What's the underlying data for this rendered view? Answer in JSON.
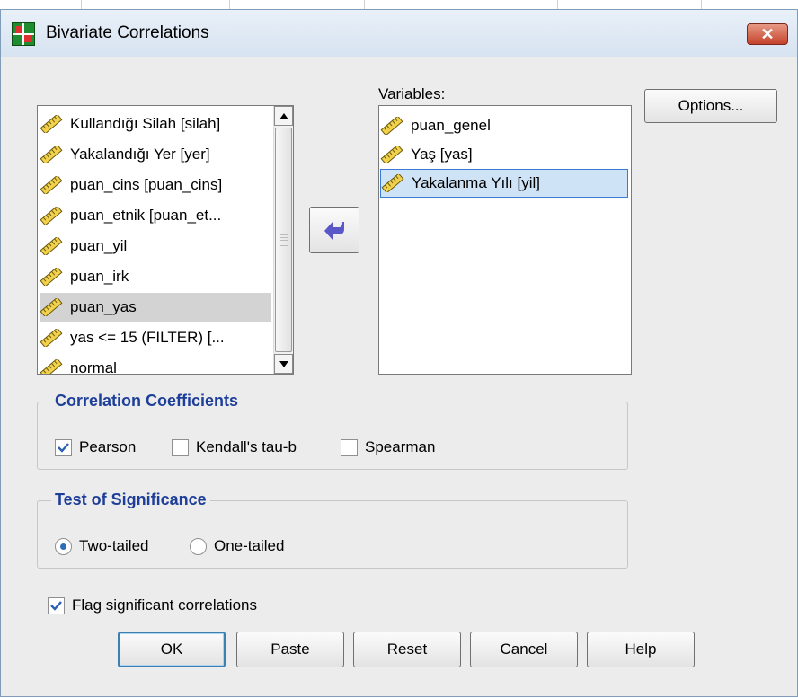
{
  "window": {
    "title": "Bivariate Correlations",
    "close_label": "✕"
  },
  "source_list": {
    "items": [
      {
        "label": "Kullandığı Silah [silah]"
      },
      {
        "label": "Yakalandığı Yer [yer]"
      },
      {
        "label": "puan_cins [puan_cins]"
      },
      {
        "label": "puan_etnik [puan_et..."
      },
      {
        "label": "puan_yil"
      },
      {
        "label": "puan_irk"
      },
      {
        "label": "puan_yas"
      },
      {
        "label": "yas <= 15 (FILTER) [..."
      },
      {
        "label": "normal"
      }
    ],
    "highlighted_index": 6
  },
  "variables": {
    "label": "Variables:",
    "items": [
      {
        "label": "puan_genel"
      },
      {
        "label": "Yaş [yas]"
      },
      {
        "label": "Yakalanma Yılı [yil]"
      }
    ],
    "selected_index": 2
  },
  "move_button": {
    "icon": "arrow-left-icon"
  },
  "options_button": {
    "label": "Options..."
  },
  "correlation_coefficients": {
    "title": "Correlation Coefficients",
    "options": [
      {
        "label": "Pearson",
        "checked": true
      },
      {
        "label": "Kendall's tau-b",
        "checked": false
      },
      {
        "label": "Spearman",
        "checked": false
      }
    ]
  },
  "test_of_significance": {
    "title": "Test of Significance",
    "options": [
      {
        "label": "Two-tailed",
        "selected": true
      },
      {
        "label": "One-tailed",
        "selected": false
      }
    ]
  },
  "flag_significant": {
    "label": "Flag significant correlations",
    "checked": true
  },
  "buttons": {
    "ok": "OK",
    "paste": "Paste",
    "reset": "Reset",
    "cancel": "Cancel",
    "help": "Help"
  },
  "colors": {
    "group_title": "#1e3f99",
    "selection_border": "#3a7bd5",
    "selection_fill": "#cfe3f7",
    "arrow": "#5a57c8"
  }
}
